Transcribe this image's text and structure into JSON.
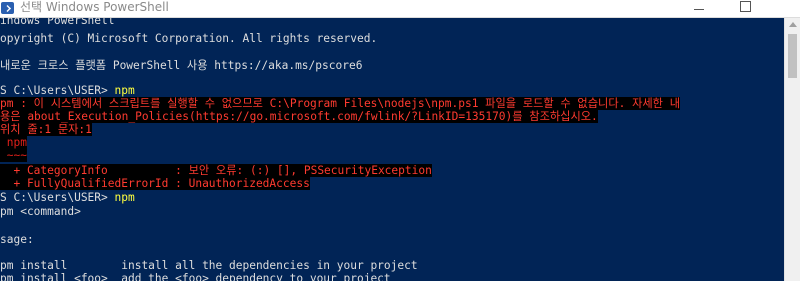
{
  "window": {
    "title": "선택 Windows PowerShell"
  },
  "icons": {
    "app": "powershell-icon",
    "minimize": "minimize-icon",
    "maximize": "maximize-icon",
    "close": "close-icon"
  },
  "colors": {
    "console_bg": "#012456",
    "text": "#dedede",
    "error": "#ff3b30",
    "command": "#ffff3f"
  },
  "terminal": {
    "header1": "indows PowerShell",
    "header2": "opyright (C) Microsoft Corporation. All rights reserved.",
    "header3": "내로운 크로스 플랫폼 PowerShell 사용 https://aka.ms/pscore6",
    "prompt1": "S C:\\Users\\USER> ",
    "cmd1": "npm",
    "err1": "pm : 이 시스템에서 스크립트를 실행할 수 없으므로 C:\\Program Files\\nodejs\\npm.ps1 파일을 로드할 수 없습니다. 자세한 내",
    "err2": "용은 about_Execution_Policies(https://go.microsoft.com/fwlink/?LinkID=135170)를 참조하십시오.",
    "err3": "위치 줄:1 문자:1",
    "err4": " npm",
    "err5": " ~~~",
    "err6": "  + CategoryInfo          : 보안 오류: (:) [], PSSecurityException",
    "err7": "  + FullyQualifiedErrorId : UnauthorizedAccess",
    "prompt2": "S C:\\Users\\USER> ",
    "cmd2": "npm",
    "out1": "pm <command>",
    "out2": "sage:",
    "out3": "pm install        install all the dependencies in your project",
    "out4": "pm install <foo>  add the <foo> dependency to your project"
  }
}
